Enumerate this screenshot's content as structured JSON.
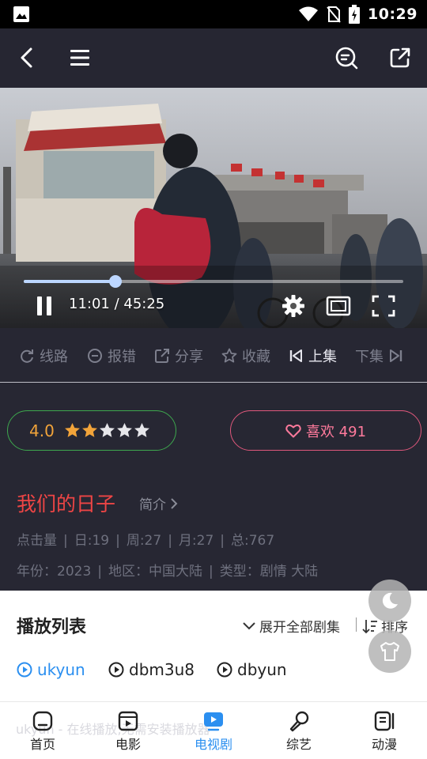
{
  "status": {
    "time": "10:29"
  },
  "player": {
    "time_display": "11:01 / 45:25",
    "progress_fraction": 0.2425
  },
  "actions": [
    {
      "label": "线路",
      "icon": "refresh-icon"
    },
    {
      "label": "报错",
      "icon": "minus-circle-icon"
    },
    {
      "label": "分享",
      "icon": "share-icon"
    },
    {
      "label": "收藏",
      "icon": "star-outline-icon"
    },
    {
      "label": "上集",
      "icon": "skip-previous-icon"
    },
    {
      "label": "下集",
      "icon": "skip-next-icon"
    }
  ],
  "rating": {
    "score": "4.0",
    "stars_filled": 2,
    "stars_total": 5
  },
  "like": {
    "label": "喜欢 491"
  },
  "show": {
    "title": "我们的日子",
    "intro_label": "简介",
    "stats": [
      "点击量",
      "日:19",
      "周:27",
      "月:27",
      "总:767"
    ],
    "info": [
      "年份：2023",
      "地区：中国大陆",
      "类型：剧情 大陆"
    ]
  },
  "playlist": {
    "title": "播放列表",
    "expand_label": "展开全部剧集",
    "sort_label": "排序",
    "sources": [
      "ukyun",
      "dbm3u8",
      "dbyun"
    ],
    "active_source": "ukyun"
  },
  "ghost_text": "ukyun - 在线播放,无需安装播放器",
  "nav": [
    {
      "label": "首页",
      "icon": "home-icon"
    },
    {
      "label": "电影",
      "icon": "film-icon"
    },
    {
      "label": "电视剧",
      "icon": "tv-play-icon"
    },
    {
      "label": "综艺",
      "icon": "microphone-icon"
    },
    {
      "label": "动漫",
      "icon": "anime-icon"
    }
  ],
  "colors": {
    "accent": "#2b8ff0",
    "title": "#ee4545",
    "rating_border": "#3ea84e",
    "like": "#ff7a9c",
    "star": "#f2a43a"
  }
}
